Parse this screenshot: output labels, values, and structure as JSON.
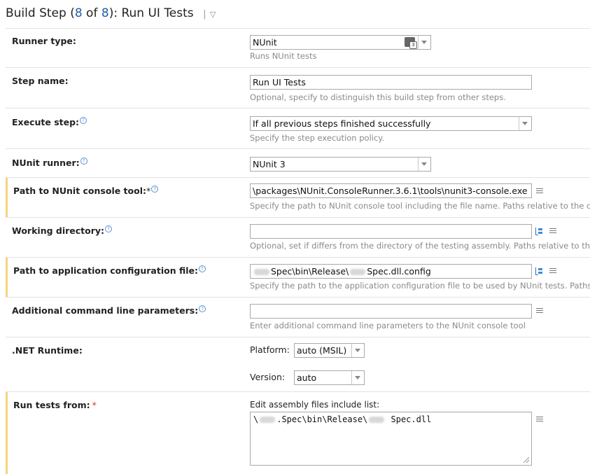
{
  "header": {
    "prefix": "Build Step (",
    "current": "8",
    "of": " of ",
    "total": "8",
    "suffix": "): Run UI Tests",
    "pipe": "|",
    "menu_arrow": "▽"
  },
  "runner_type": {
    "label": "Runner type:",
    "value": "NUnit",
    "note": "Runs NUnit tests"
  },
  "step_name": {
    "label": "Step name:",
    "value": "Run UI Tests",
    "note": "Optional, specify to distinguish this build step from other steps."
  },
  "execute_step": {
    "label": "Execute step:",
    "value": "If all previous steps finished successfully",
    "note": "Specify the step execution policy."
  },
  "nunit_runner": {
    "label": "NUnit runner:",
    "value": "NUnit 3"
  },
  "console_tool": {
    "label": "Path to NUnit console tool:",
    "star": "*",
    "value": "\\packages\\NUnit.ConsoleRunner.3.6.1\\tools\\nunit3-console.exe",
    "note": "Specify the path to NUnit console tool including the file name. Paths relative to the checkout directory are supported."
  },
  "working_dir": {
    "label": "Working directory:",
    "value": "",
    "note": "Optional, set if differs from the directory of the testing assembly. Paths relative to the checkout directory are supported."
  },
  "app_config": {
    "label": "Path to application configuration file:",
    "value_a": "Spec\\bin\\Release\\",
    "value_b": "Spec.dll.config",
    "note": "Specify the path to the application configuration file to be used by NUnit tests. Paths relative to the checkout directory are supported."
  },
  "additional_params": {
    "label": "Additional command line parameters:",
    "value": "",
    "note": "Enter additional command line parameters to the NUnit console tool"
  },
  "dotnet_runtime": {
    "label": ".NET Runtime:",
    "platform_label": "Platform:",
    "platform_value": "auto (MSIL)",
    "version_label": "Version:",
    "version_value": "auto"
  },
  "run_tests_from": {
    "label": "Run tests from:",
    "star": "*",
    "edit_label": "Edit assembly files include list:",
    "text_a": "\\",
    "text_b": ".Spec\\bin\\Release\\",
    "text_c": " Spec.dll"
  }
}
